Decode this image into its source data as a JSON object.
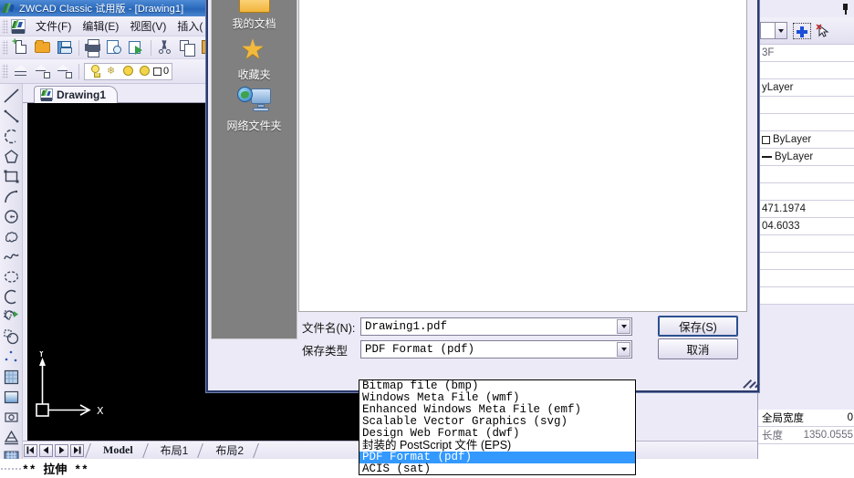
{
  "window": {
    "title": "ZWCAD Classic 试用版 - [Drawing1]",
    "app_icon": "zwcad-logo-icon"
  },
  "menubar": {
    "items": [
      {
        "label": "文件(F)"
      },
      {
        "label": "编辑(E)"
      },
      {
        "label": "视图(V)"
      },
      {
        "label": "插入("
      }
    ]
  },
  "toolbar_standard": {
    "buttons": [
      {
        "name": "new-file-button",
        "icon": "new-document-icon"
      },
      {
        "name": "open-file-button",
        "icon": "open-folder-icon"
      },
      {
        "name": "save-file-button",
        "icon": "floppy-disk-icon"
      },
      {
        "name": "plot-button",
        "icon": "printer-icon"
      },
      {
        "name": "print-preview-button",
        "icon": "print-preview-icon"
      },
      {
        "name": "export-button",
        "icon": "export-arrow-icon"
      },
      {
        "name": "cut-button",
        "icon": "scissors-icon"
      },
      {
        "name": "copy-button",
        "icon": "copy-icon"
      },
      {
        "name": "paste-button",
        "icon": "paste-icon"
      }
    ]
  },
  "toolbar_layer": {
    "buttons": [
      {
        "name": "layer-properties-button",
        "icon": "layers-icon"
      },
      {
        "name": "layer-previous-button",
        "icon": "layer-previous-icon"
      },
      {
        "name": "layer-states-button",
        "icon": "layer-states-icon"
      }
    ],
    "layer_control": {
      "on_icon": "lightbulb-icon",
      "freeze_icon": "snowflake-icon",
      "freeze_vp_icon": "sun-icon",
      "lock_icon": "lock-icon",
      "layer_name": "0"
    }
  },
  "draw_toolbar": {
    "tools": [
      {
        "name": "line-tool",
        "icon": "line-icon"
      },
      {
        "name": "construction-line-tool",
        "icon": "construction-line-icon"
      },
      {
        "name": "polyline-tool",
        "icon": "polyline-icon"
      },
      {
        "name": "polygon-tool",
        "icon": "polygon-icon"
      },
      {
        "name": "rectangle-tool",
        "icon": "rectangle-icon"
      },
      {
        "name": "arc-tool",
        "icon": "arc-icon"
      },
      {
        "name": "circle-tool",
        "icon": "circle-icon"
      },
      {
        "name": "revision-cloud-tool",
        "icon": "revision-cloud-icon"
      },
      {
        "name": "spline-tool",
        "icon": "spline-icon"
      },
      {
        "name": "ellipse-tool",
        "icon": "ellipse-icon"
      },
      {
        "name": "ellipse-arc-tool",
        "icon": "ellipse-arc-icon"
      },
      {
        "name": "insert-block-tool",
        "icon": "insert-block-icon"
      },
      {
        "name": "make-block-tool",
        "icon": "make-block-icon"
      },
      {
        "name": "point-tool",
        "icon": "point-icon"
      },
      {
        "name": "hatch-tool",
        "icon": "hatch-icon"
      },
      {
        "name": "gradient-tool",
        "icon": "gradient-icon"
      },
      {
        "name": "region-tool",
        "icon": "region-icon"
      },
      {
        "name": "table-tool",
        "icon": "table-icon"
      },
      {
        "name": "multiline-text-tool",
        "icon": "text-icon"
      }
    ]
  },
  "document_tab": {
    "label": "Drawing1",
    "icon": "dwg-file-icon"
  },
  "layout_tabs": {
    "nav": [
      {
        "name": "first-layout-button",
        "icon": "first-icon"
      },
      {
        "name": "previous-layout-button",
        "icon": "previous-icon"
      },
      {
        "name": "next-layout-button",
        "icon": "next-icon"
      },
      {
        "name": "last-layout-button",
        "icon": "last-icon"
      }
    ],
    "tabs": [
      {
        "label": "Model",
        "active": true
      },
      {
        "label": "布局1",
        "active": false
      },
      {
        "label": "布局2",
        "active": false
      }
    ]
  },
  "command_line": {
    "text": "** 拉伸 **"
  },
  "properties_panel": {
    "pin_icon": "pin-icon",
    "toolbar": {
      "selection_combo_value": "",
      "quick_select_icon": "quick-select-icon",
      "add_selection_icon": "add-selection-icon"
    },
    "rows": [
      {
        "label": "3F",
        "value": "",
        "muted": true
      },
      {
        "label": "",
        "value": ""
      },
      {
        "label": "yLayer",
        "value": ""
      },
      {
        "label": "",
        "value": ""
      },
      {
        "label": "",
        "value": ""
      },
      {
        "label": "ByLayer",
        "value": "",
        "swatch": "box"
      },
      {
        "label": "ByLayer",
        "value": "",
        "swatch": "line"
      },
      {
        "label": "",
        "value": ""
      },
      {
        "label": "",
        "value": ""
      },
      {
        "label": "471.1974",
        "value": ""
      },
      {
        "label": "04.6033",
        "value": ""
      },
      {
        "label": "",
        "value": ""
      },
      {
        "label": "",
        "value": ""
      },
      {
        "label": "",
        "value": ""
      },
      {
        "label": "",
        "value": ""
      }
    ],
    "footer_rows": [
      {
        "label": "全局宽度",
        "value": "0"
      },
      {
        "label": "长度",
        "value": "1350.0555"
      }
    ]
  },
  "save_dialog": {
    "places": [
      {
        "label": "我的文档",
        "icon": "my-documents-icon"
      },
      {
        "label": "收藏夹",
        "icon": "favorites-star-icon"
      },
      {
        "label": "网络文件夹",
        "icon": "network-folder-icon"
      }
    ],
    "filename": {
      "label": "文件名(N):",
      "value": "Drawing1.pdf",
      "placeholder": "Drawing1.pdf"
    },
    "filetype": {
      "label": "保存类型",
      "value": "PDF Format (pdf)"
    },
    "buttons": {
      "save": "保存(S)",
      "cancel": "取消"
    },
    "filetype_options": [
      {
        "label": "Bitmap file (bmp)",
        "selected": false,
        "cjk": false
      },
      {
        "label": "Windows Meta File (wmf)",
        "selected": false,
        "cjk": false
      },
      {
        "label": "Enhanced Windows Meta File (emf)",
        "selected": false,
        "cjk": false
      },
      {
        "label": "Scalable Vector Graphics (svg)",
        "selected": false,
        "cjk": false
      },
      {
        "label": "Design Web Format (dwf)",
        "selected": false,
        "cjk": false
      },
      {
        "label": "封装的 PostScript 文件 (EPS)",
        "selected": false,
        "cjk": true
      },
      {
        "label": "PDF Format (pdf)",
        "selected": true,
        "cjk": false
      },
      {
        "label": "ACIS (sat)",
        "selected": false,
        "cjk": false
      }
    ]
  },
  "colors": {
    "titlebar_blue": "#2f6fc0",
    "dialog_border": "#2a3a6b",
    "places_bg": "#808080",
    "selection_blue": "#3399ff",
    "canvas_black": "#000000",
    "panel_bg": "#eceaf6"
  }
}
